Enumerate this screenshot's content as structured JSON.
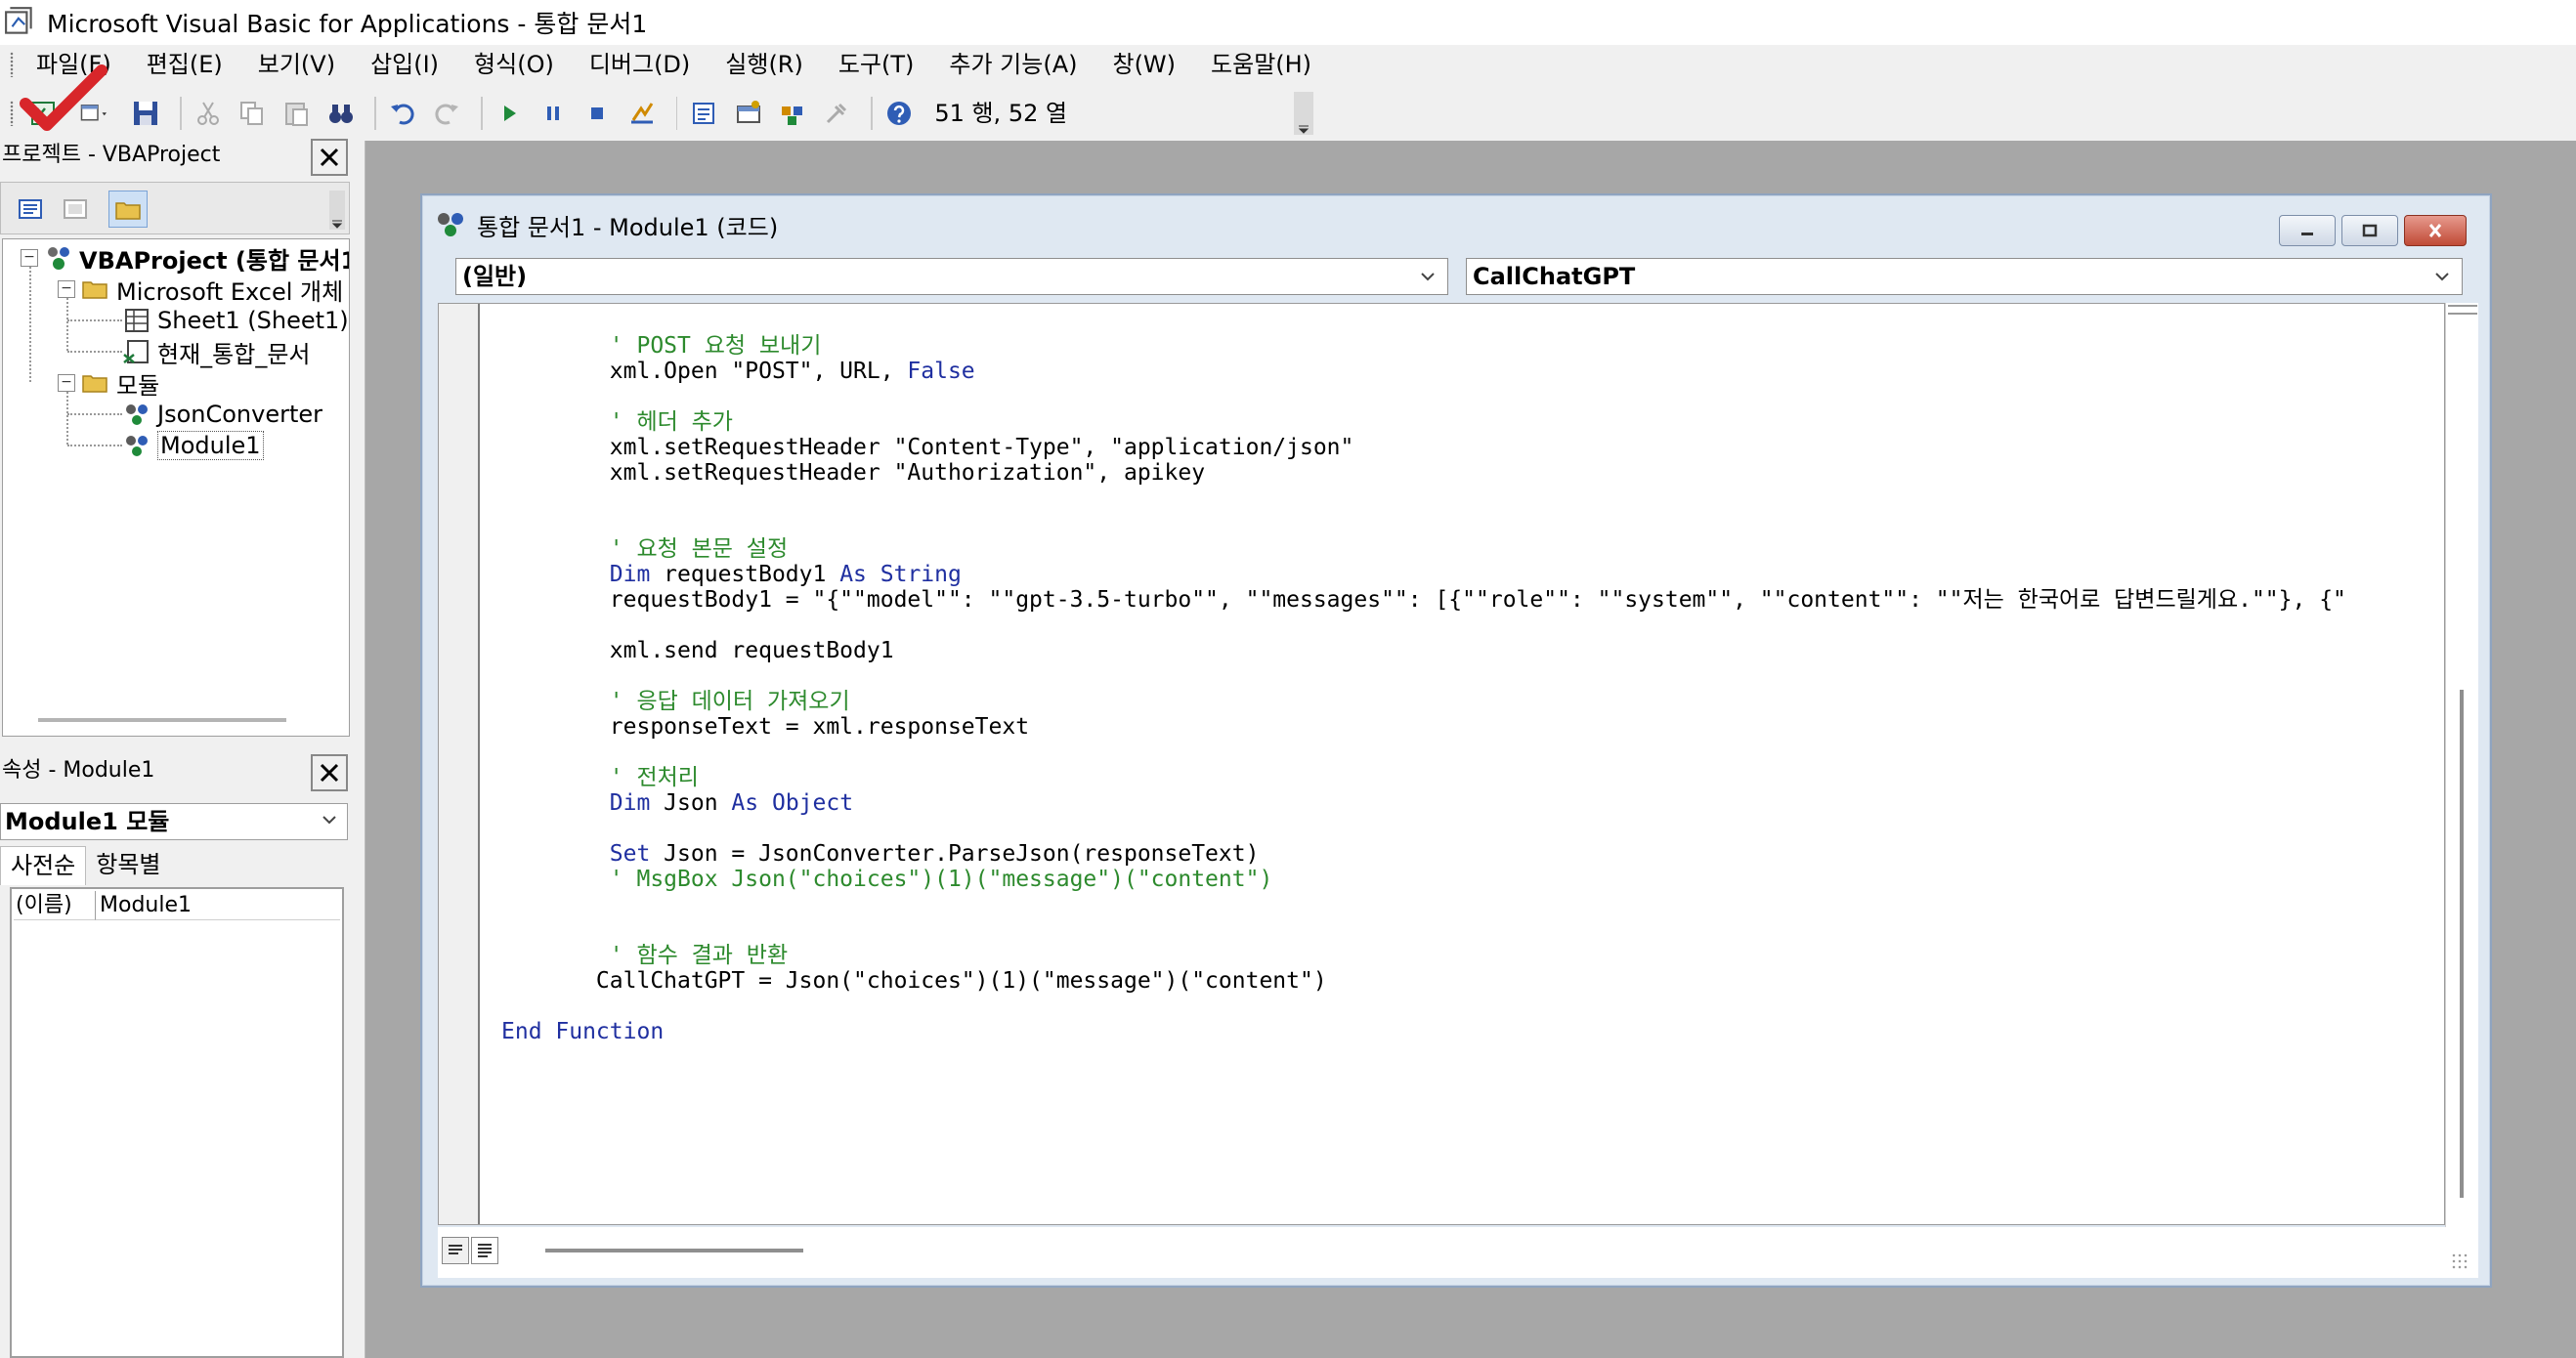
{
  "window": {
    "title": "Microsoft Visual Basic for Applications - 통합 문서1"
  },
  "menu": {
    "items": [
      "파일(F)",
      "편집(E)",
      "보기(V)",
      "삽입(I)",
      "형식(O)",
      "디버그(D)",
      "실행(R)",
      "도구(T)",
      "추가 기능(A)",
      "창(W)",
      "도움말(H)"
    ]
  },
  "toolbar": {
    "cursor_position": "51 행, 52 열"
  },
  "project_pane": {
    "title": "프로젝트 - VBAProject",
    "tree": {
      "root": "VBAProject (통합 문서1)",
      "excel_objects": "Microsoft Excel 개체",
      "sheet1": "Sheet1 (Sheet1)",
      "workbook": "현재_통합_문서",
      "modules": "모듈",
      "json_converter": "JsonConverter",
      "module1": "Module1"
    }
  },
  "properties_pane": {
    "title": "속성 - Module1",
    "object_select": "Module1 모듈",
    "tabs": [
      "사전순",
      "항목별"
    ],
    "row": {
      "key": "(이름)",
      "value": "Module1"
    }
  },
  "code_window": {
    "title": "통합 문서1 - Module1 (코드)",
    "object_dropdown": "(일반)",
    "procedure_dropdown": "CallChatGPT",
    "lines": [
      {
        "text": "        ' POST 요청 보내기",
        "kind": "comment"
      },
      {
        "text": "        xml.Open \"POST\", URL, ",
        "kind": "normal",
        "tail": "False",
        "tail_kind": "kw"
      },
      {
        "text": "",
        "kind": "normal"
      },
      {
        "text": "        ' 헤더 추가",
        "kind": "comment"
      },
      {
        "text": "        xml.setRequestHeader \"Content-Type\", \"application/json\"",
        "kind": "normal"
      },
      {
        "text": "        xml.setRequestHeader \"Authorization\", apikey",
        "kind": "normal"
      },
      {
        "text": "",
        "kind": "normal"
      },
      {
        "text": "",
        "kind": "normal"
      },
      {
        "text": "        ' 요청 본문 설정",
        "kind": "comment"
      },
      {
        "text": "        Dim requestBody1 As String",
        "kind": "kw"
      },
      {
        "text": "        requestBody1 = \"{\"\"model\"\": \"\"gpt-3.5-turbo\"\", \"\"messages\"\": [{\"\"role\"\": \"\"system\"\", \"\"content\"\": \"\"저는 한국어로 답변드릴게요.\"\"}, {\"",
        "kind": "normal"
      },
      {
        "text": "",
        "kind": "normal"
      },
      {
        "text": "        xml.send requestBody1",
        "kind": "normal"
      },
      {
        "text": "",
        "kind": "normal"
      },
      {
        "text": "        ' 응답 데이터 가져오기",
        "kind": "comment"
      },
      {
        "text": "        responseText = xml.responseText",
        "kind": "normal"
      },
      {
        "text": "",
        "kind": "normal"
      },
      {
        "text": "        ' 전처리",
        "kind": "comment"
      },
      {
        "text": "        Dim Json As Object",
        "kind": "kw"
      },
      {
        "text": "",
        "kind": "normal"
      },
      {
        "text": "        Set ",
        "kind": "kw",
        "tail": "Json = JsonConverter.ParseJson(responseText)",
        "tail_kind": "normal"
      },
      {
        "text": "        ' MsgBox Json(\"choices\")(1)(\"message\")(\"content\")",
        "kind": "comment"
      },
      {
        "text": "",
        "kind": "normal"
      },
      {
        "text": "",
        "kind": "normal"
      },
      {
        "text": "        ' 함수 결과 반환",
        "kind": "comment"
      },
      {
        "text": "       CallChatGPT = Json(\"choices\")(1)(\"message\")(\"content\")",
        "kind": "normal"
      },
      {
        "text": "",
        "kind": "normal"
      },
      {
        "text": "End Function",
        "kind": "kw"
      }
    ]
  },
  "colors": {
    "comment": "#2d8a2d",
    "keyword": "#1f2fa0",
    "mdi_background": "#a7a7a7"
  }
}
